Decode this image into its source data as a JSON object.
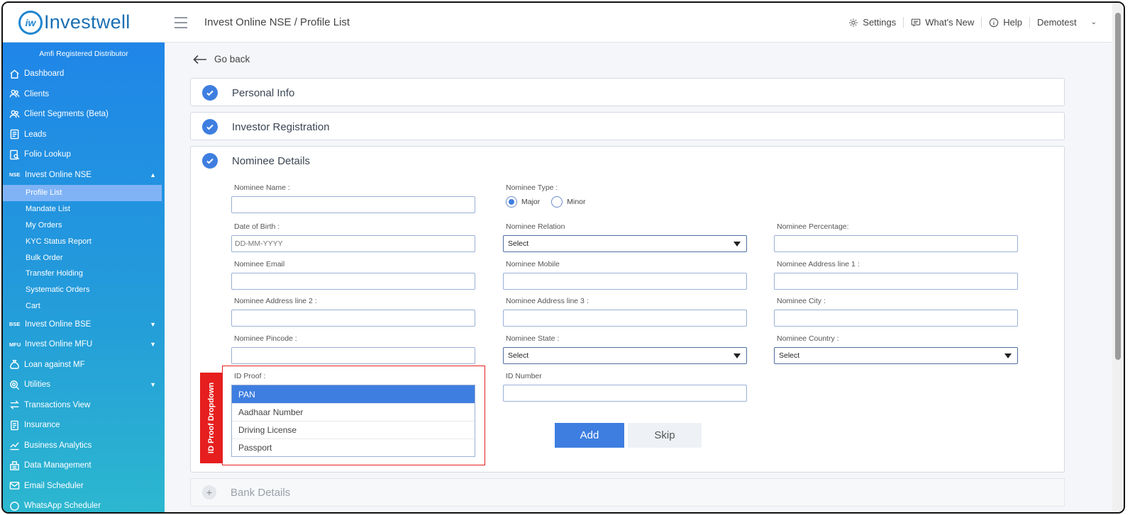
{
  "header": {
    "logo_text": "Investwell",
    "logo_badge": "iw",
    "breadcrumb": "Invest Online NSE / Profile List",
    "settings": "Settings",
    "whats_new": "What's New",
    "help": "Help",
    "user": "Demotest"
  },
  "sidebar": {
    "heading": "Amfi Registered Distributor",
    "items": {
      "dashboard": "Dashboard",
      "clients": "Clients",
      "client_segments": "Client Segments (Beta)",
      "leads": "Leads",
      "folio_lookup": "Folio Lookup",
      "invest_nse": "Invest Online NSE",
      "nse_tag": "NSE",
      "invest_bse": "Invest Online BSE",
      "bse_tag": "BSE",
      "invest_mfu": "Invest Online MFU",
      "mfu_tag": "MFU",
      "loan": "Loan against MF",
      "utilities": "Utilities",
      "transactions": "Transactions View",
      "insurance": "Insurance",
      "business_analytics": "Business Analytics",
      "data_management": "Data Management",
      "email_scheduler": "Email Scheduler",
      "whatsapp_scheduler": "WhatsApp Scheduler"
    },
    "sub": {
      "profile_list": "Profile List",
      "mandate_list": "Mandate List",
      "my_orders": "My Orders",
      "kyc_status": "KYC Status Report",
      "bulk_order": "Bulk Order",
      "transfer_holding": "Transfer Holding",
      "systematic_orders": "Systematic Orders",
      "cart": "Cart"
    }
  },
  "main": {
    "go_back": "Go back",
    "sections": {
      "personal_info": "Personal Info",
      "investor_registration": "Investor Registration",
      "nominee_details": "Nominee Details",
      "bank_details": "Bank Details"
    },
    "form": {
      "nominee_name": "Nominee Name :",
      "nominee_type": "Nominee Type :",
      "type_major": "Major",
      "type_minor": "Minor",
      "dob": "Date of Birth :",
      "dob_placeholder": "DD-MM-YYYY",
      "relation": "Nominee Relation",
      "relation_value": "Select",
      "percentage": "Nominee Percentage:",
      "email": "Nominee Email",
      "mobile": "Nominee Mobile",
      "addr1": "Nominee Address line 1 :",
      "addr2": "Nominee Address line 2 :",
      "addr3": "Nominee Address line 3 :",
      "city": "Nominee City :",
      "pincode": "Nominee Pincode :",
      "state": "Nominee State :",
      "state_value": "Select",
      "country": "Nominee Country :",
      "country_value": "Select",
      "id_proof": "ID Proof :",
      "id_number": "ID Number",
      "id_options": [
        "PAN",
        "Aadhaar Number",
        "Driving License",
        "Passport"
      ]
    },
    "annotation": "ID Proof Dropdown",
    "add_label": "Add",
    "skip_label": "Skip"
  },
  "colors": {
    "accent": "#3e7ee0",
    "sidebar_top": "#1f86e8",
    "sidebar_bottom": "#2cb7cf",
    "annotation_red": "#e61e1e"
  }
}
